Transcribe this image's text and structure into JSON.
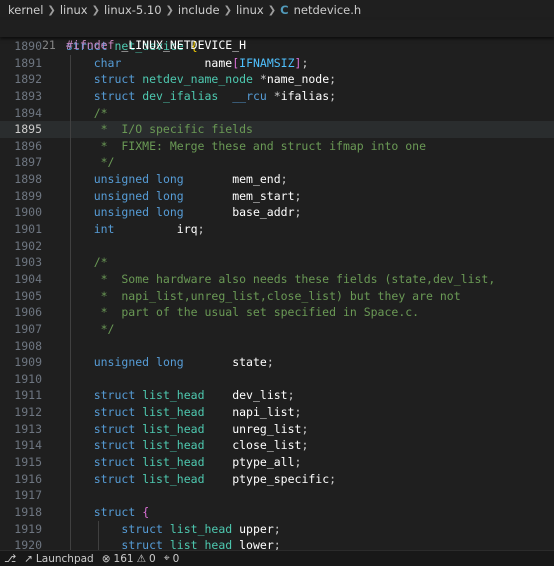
{
  "breadcrumb": {
    "items": [
      "kernel",
      "linux",
      "linux-5.10",
      "include",
      "linux"
    ],
    "file": "netdevice.h"
  },
  "sticky": {
    "line": "21",
    "text": "#ifndef _LINUX_NETDEVICE_H"
  },
  "status": {
    "launchpad": "Launchpad",
    "errors": "161",
    "warnings": "0",
    "ports": "0"
  },
  "lines": [
    {
      "n": "1890",
      "t": "struct net_device {"
    },
    {
      "n": "1891",
      "t": "char name[IFNAMSIZ];"
    },
    {
      "n": "1892",
      "t": "struct netdev_name_node *name_node;"
    },
    {
      "n": "1893",
      "t": "struct dev_ifalias __rcu *ifalias;"
    },
    {
      "n": "1894",
      "t": "/*"
    },
    {
      "n": "1895",
      "t": "* I/O specific fields"
    },
    {
      "n": "1896",
      "t": "* FIXME: Merge these and struct ifmap into one"
    },
    {
      "n": "1897",
      "t": "*/"
    },
    {
      "n": "1898",
      "t": "unsigned long mem_end;"
    },
    {
      "n": "1899",
      "t": "unsigned long mem_start;"
    },
    {
      "n": "1900",
      "t": "unsigned long base_addr;"
    },
    {
      "n": "1901",
      "t": "int irq;"
    },
    {
      "n": "1902",
      "t": ""
    },
    {
      "n": "1903",
      "t": "/*"
    },
    {
      "n": "1904",
      "t": "* Some hardware also needs these fields (state,dev_list,"
    },
    {
      "n": "1905",
      "t": "* napi_list,unreg_list,close_list) but they are not"
    },
    {
      "n": "1906",
      "t": "* part of the usual set specified in Space.c."
    },
    {
      "n": "1907",
      "t": "*/"
    },
    {
      "n": "1908",
      "t": ""
    },
    {
      "n": "1909",
      "t": "unsigned long state;"
    },
    {
      "n": "1910",
      "t": ""
    },
    {
      "n": "1911",
      "t": "struct list_head dev_list;"
    },
    {
      "n": "1912",
      "t": "struct list_head napi_list;"
    },
    {
      "n": "1913",
      "t": "struct list_head unreg_list;"
    },
    {
      "n": "1914",
      "t": "struct list_head close_list;"
    },
    {
      "n": "1915",
      "t": "struct list_head ptype_all;"
    },
    {
      "n": "1916",
      "t": "struct list_head ptype_specific;"
    },
    {
      "n": "1917",
      "t": ""
    },
    {
      "n": "1918",
      "t": "struct {"
    },
    {
      "n": "1919",
      "t": "struct list_head upper;"
    },
    {
      "n": "1920",
      "t": "struct list_head lower;"
    }
  ],
  "colors": {
    "background": "#1f1f1f",
    "keyword": "#569cd6",
    "type": "#4ec9b0",
    "comment": "#6a9955",
    "bracket": "#ffd700",
    "file_icon": "#519aba"
  }
}
